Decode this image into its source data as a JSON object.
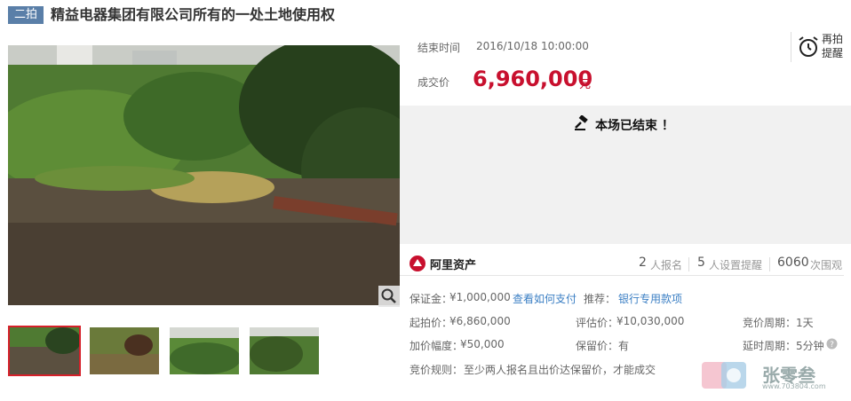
{
  "header": {
    "badge": "二拍",
    "title": "精益电器集团有限公司所有的一处土地使用权"
  },
  "auction": {
    "end_time_label": "结束时间",
    "end_time": "2016/10/18 10:00:00",
    "deal_price_label": "成交价",
    "deal_price": "6,960,000",
    "currency": "元",
    "remind_line1": "再拍",
    "remind_line2": "提醒",
    "ended_text": "本场已结束 ！"
  },
  "platform": {
    "logo_text": "阿里资产",
    "stats": [
      {
        "num": "2",
        "label": "人报名"
      },
      {
        "num": "5",
        "label": "人设置提醒"
      },
      {
        "num": "6060",
        "label": "次围观"
      }
    ]
  },
  "details": {
    "deposit_label": "保证金：",
    "deposit": "¥1,000,000",
    "how_to_pay": "查看如何支付",
    "recommend_label": "推荐：",
    "bank_loan": "银行专用款项",
    "start_price_label": "起拍价：",
    "start_price": "¥6,860,000",
    "appraisal_label": "评估价：",
    "appraisal": "¥10,030,000",
    "bid_period_label": "竞价周期：",
    "bid_period": "1天",
    "increment_label": "加价幅度：",
    "increment": "¥50,000",
    "reserve_label": "保留价：",
    "reserve": "有",
    "delay_label": "延时周期：",
    "delay": "5分钟",
    "rules_label": "竞价规则：",
    "rules": "至少两人报名且出价达保留价，才能成交"
  },
  "watermark": {
    "text": "张零叁",
    "url": "www.703804.com"
  },
  "colors": {
    "accent_red": "#c8102e",
    "link_blue": "#3b7fc4",
    "badge_blue": "#5a7fa8"
  }
}
